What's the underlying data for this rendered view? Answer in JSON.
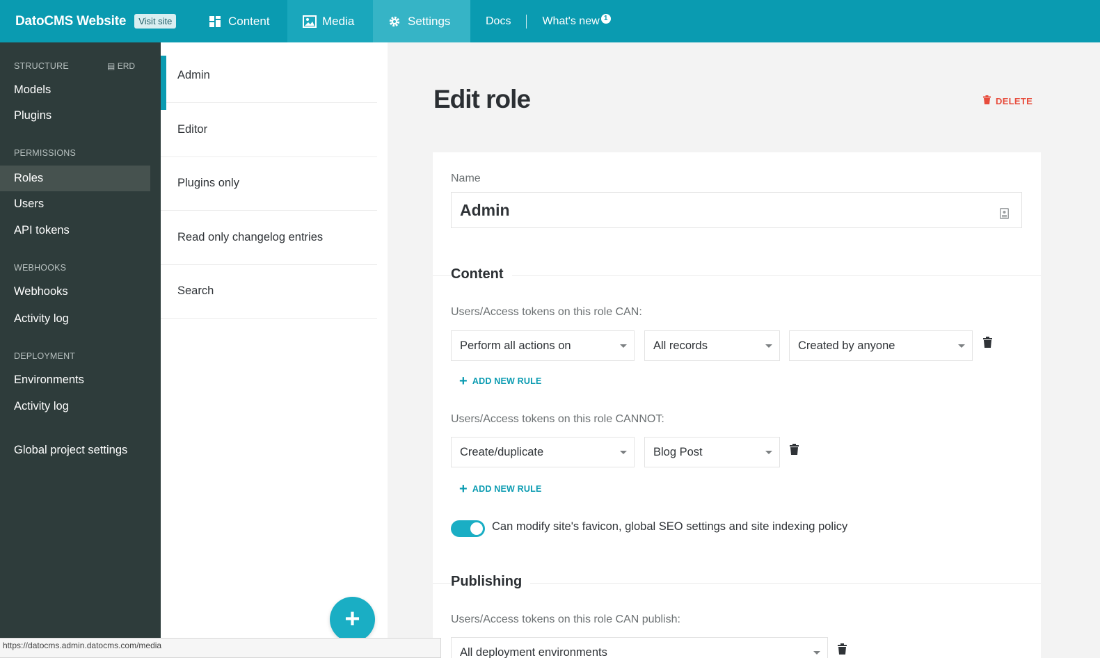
{
  "header": {
    "brand": "DatoCMS Website",
    "visit_site": "Visit site",
    "tabs": {
      "content": "Content",
      "media": "Media",
      "settings": "Settings"
    },
    "docs": "Docs",
    "whats_new": "What's new",
    "whats_new_badge": "1",
    "colors": {
      "bar": "#0a9bb1",
      "media_tab": "#1aa7bc",
      "settings_tab": "#36b4c6"
    }
  },
  "sidebar": {
    "structure_label": "STRUCTURE",
    "erd_label": "ERD",
    "models": "Models",
    "plugins": "Plugins",
    "permissions_label": "PERMISSIONS",
    "roles": "Roles",
    "users": "Users",
    "api_tokens": "API tokens",
    "webhooks_label": "WEBHOOKS",
    "webhooks": "Webhooks",
    "webhooks_activity_log": "Activity log",
    "deployment_label": "DEPLOYMENT",
    "environments": "Environments",
    "deployment_activity_log": "Activity log",
    "global_settings": "Global project settings"
  },
  "roles": [
    "Admin",
    "Editor",
    "Plugins only",
    "Read only changelog entries",
    "Search"
  ],
  "main": {
    "title": "Edit role",
    "delete": "DELETE",
    "name_label": "Name",
    "name_value": "Admin",
    "content_heading": "Content",
    "can_label": "Users/Access tokens on this role CAN:",
    "can_rule": {
      "action": "Perform all actions on",
      "scope": "All records",
      "creator": "Created by anyone"
    },
    "add_new_rule": "ADD NEW RULE",
    "cannot_label": "Users/Access tokens on this role CANNOT:",
    "cannot_rule": {
      "action": "Create/duplicate",
      "model": "Blog Post"
    },
    "seo_toggle_label": "Can modify site's favicon, global SEO settings and site indexing policy",
    "seo_toggle_on": true,
    "publishing_heading": "Publishing",
    "publish_label": "Users/Access tokens on this role CAN publish:",
    "publish_env": "All deployment environments"
  },
  "status_url": "https://datocms.admin.datocms.com/media"
}
